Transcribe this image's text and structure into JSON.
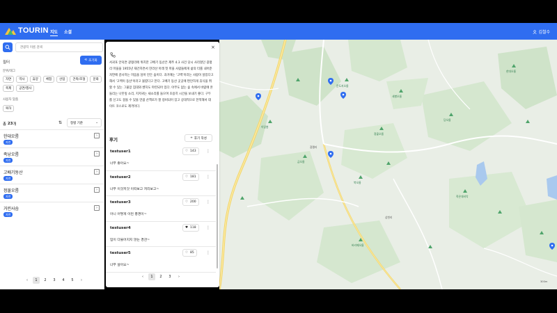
{
  "app": {
    "brand": "TOURIN",
    "user_name": "김철수"
  },
  "nav": {
    "links": [
      "지도",
      "소셜"
    ]
  },
  "sidebar": {
    "search_placeholder": "관광지 이름 검색",
    "filter_label": "필터",
    "reset_label": "초기화",
    "category_label": "분위/태그",
    "tags": [
      "자연",
      "역사",
      "휴양",
      "체험",
      "산업",
      "건축/조형",
      "문화",
      "축제",
      "공연/행사"
    ],
    "custom_label": "사용자 맞춤",
    "custom_tags": [
      "복하"
    ],
    "count_prefix": "총",
    "count_value": "23",
    "count_suffix": "개",
    "sort_label": "정렬 기준",
    "places": [
      {
        "name": "한대오름",
        "badge": "자연"
      },
      {
        "name": "족낭오름",
        "badge": "자연"
      },
      {
        "name": "고배기동산",
        "badge": "자연"
      },
      {
        "name": "정물오름",
        "badge": "자연"
      },
      {
        "name": "거린사슴",
        "badge": "자연"
      }
    ],
    "pages": [
      "1",
      "2",
      "3",
      "4",
      "5"
    ],
    "current_page": "1"
  },
  "detail": {
    "description": "서귀포 안덕면 광평리에 위치한 고배기 동산은 제주 4.3 사건 당시 사라졌던 광평리 마을을 1955년 재건하면서 한라산 아래 첫 마을 사람들에게 삶의 터를 내어준 자연에 감사하는 마음을 담아 만든 숲이다. 과거에는 '고백'이라는 사람이 살았다고 해서 '고백이 동산'이라고 불렸다고 한다. 고배기 동산 곳곳에 편안하게 휴식을 취할 수 있는 그물망 침대와 벤치도 마련되어 있다. 아무도 없는 숲 속에서 바람에 흔들리는 나뭇잎 소리, 지저귀는 새소리를 들으며 조용히 시간을 보내기 좋다. 구두를 신고도 걸을 수 있을 만큼 산책로가 잘 정비되어 있고 상대적으로 한적해서 데이트 코스로도 제격이다.",
    "reviews_title": "후기",
    "write_label": "후기 작성",
    "reviews": [
      {
        "user": "testuser1",
        "likes": "143",
        "text": "너무 좋아요~",
        "liked": false
      },
      {
        "user": "testuser2",
        "likes": "181",
        "text": "너무 이것저것 이따보고 저리보고~",
        "liked": false
      },
      {
        "user": "testuser3",
        "likes": "200",
        "text": "아니 어떻게 이런 풍경이~",
        "liked": false
      },
      {
        "user": "testuser4",
        "likes": "118",
        "text": "입이 다물어지지 않는 경관~",
        "liked": true
      },
      {
        "user": "testuser5",
        "likes": "85",
        "text": "너무 살아요~",
        "liked": false
      }
    ],
    "pages": [
      "1",
      "2",
      "3"
    ],
    "current_page": "1"
  },
  "map": {
    "credit": "© NAVER Corp.",
    "scale": "300m",
    "places": [
      {
        "name": "문도지오름"
      },
      {
        "name": "새별오름"
      },
      {
        "name": "이달봉"
      },
      {
        "name": "금오름"
      },
      {
        "name": "북오름"
      },
      {
        "name": "정물오름"
      },
      {
        "name": "당오름"
      },
      {
        "name": "한대오름"
      },
      {
        "name": "광평리"
      },
      {
        "name": "상천리"
      },
      {
        "name": "족은대비악"
      },
      {
        "name": "바리메오름"
      }
    ]
  }
}
